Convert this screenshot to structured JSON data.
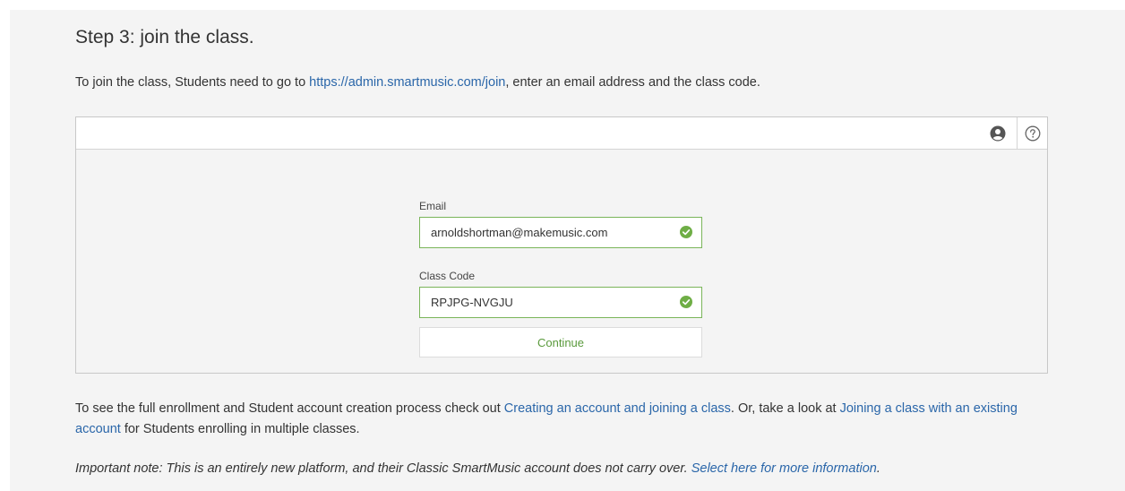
{
  "heading": "Step 3: join the class.",
  "intro": {
    "before": "To join the class, Students need to go to ",
    "link": "https://admin.smartmusic.com/join",
    "after": ", enter an email address and the class code."
  },
  "frame": {
    "topbar_icons": [
      "user-circle-icon",
      "help-circle-icon"
    ],
    "email_label": "Email",
    "email_value": "arnoldshortman@makemusic.com",
    "code_label": "Class Code",
    "code_value": "RPJPG-NVGJU",
    "continue_label": "Continue"
  },
  "process": {
    "before": "To see the full enrollment and Student account creation process check out ",
    "link1": "Creating an account and joining a class",
    "middle": ". Or, take a look at ",
    "link2": "Joining a class with an existing account",
    "after": " for Students enrolling in multiple classes."
  },
  "note": {
    "text": "Important note: This is an entirely new platform, and their Classic SmartMusic account does not carry over. ",
    "link": "Select here for more information",
    "end": "."
  },
  "colors": {
    "link": "#2a66a9",
    "valid_border": "#7ab559",
    "check": "#6fae46",
    "button_text": "#5a9a3c"
  }
}
